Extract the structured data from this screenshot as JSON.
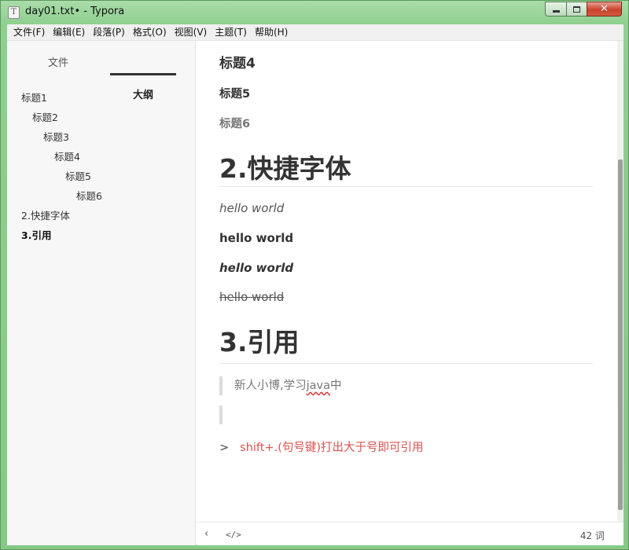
{
  "window": {
    "title": "day01.txt• - Typora",
    "app_icon": "T",
    "controls": {
      "minimize": "minimize-icon",
      "maximize": "maximize-icon",
      "close": "✕"
    }
  },
  "menubar": {
    "items": [
      "文件(F)",
      "编辑(E)",
      "段落(P)",
      "格式(O)",
      "视图(V)",
      "主题(T)",
      "帮助(H)"
    ]
  },
  "sidebar": {
    "tabs": {
      "files": "文件",
      "outline": "大纲"
    },
    "active_tab": "outline",
    "outline": [
      {
        "label": "标题1",
        "level": 1
      },
      {
        "label": "标题2",
        "level": 2
      },
      {
        "label": "标题3",
        "level": 3
      },
      {
        "label": "标题4",
        "level": 4
      },
      {
        "label": "标题5",
        "level": 5
      },
      {
        "label": "标题6",
        "level": 6
      },
      {
        "label": "2.快捷字体",
        "level": 1
      },
      {
        "label": "3.引用",
        "level": 1,
        "active": true
      }
    ]
  },
  "editor": {
    "h4": "标题4",
    "h5": "标题5",
    "h6": "标题6",
    "section2_title": "2.快捷字体",
    "italic_text": "hello world",
    "bold_text": "hello world",
    "bold_italic_text": "hello world",
    "strike_text": "hello world",
    "section3_title": "3.引用",
    "quote_prefix": "新人小博,学习",
    "quote_misspelled": "java",
    "quote_suffix": "中",
    "gt_marker": ">",
    "gt_text": "shift+.(句号键)打出大于号即可引用"
  },
  "footer": {
    "back_icon": "‹",
    "code_icon": "</>",
    "word_count": "42 词"
  },
  "colors": {
    "frame": "#8fcf8f",
    "accent_red": "#d9534f",
    "heading_text": "#333333"
  }
}
